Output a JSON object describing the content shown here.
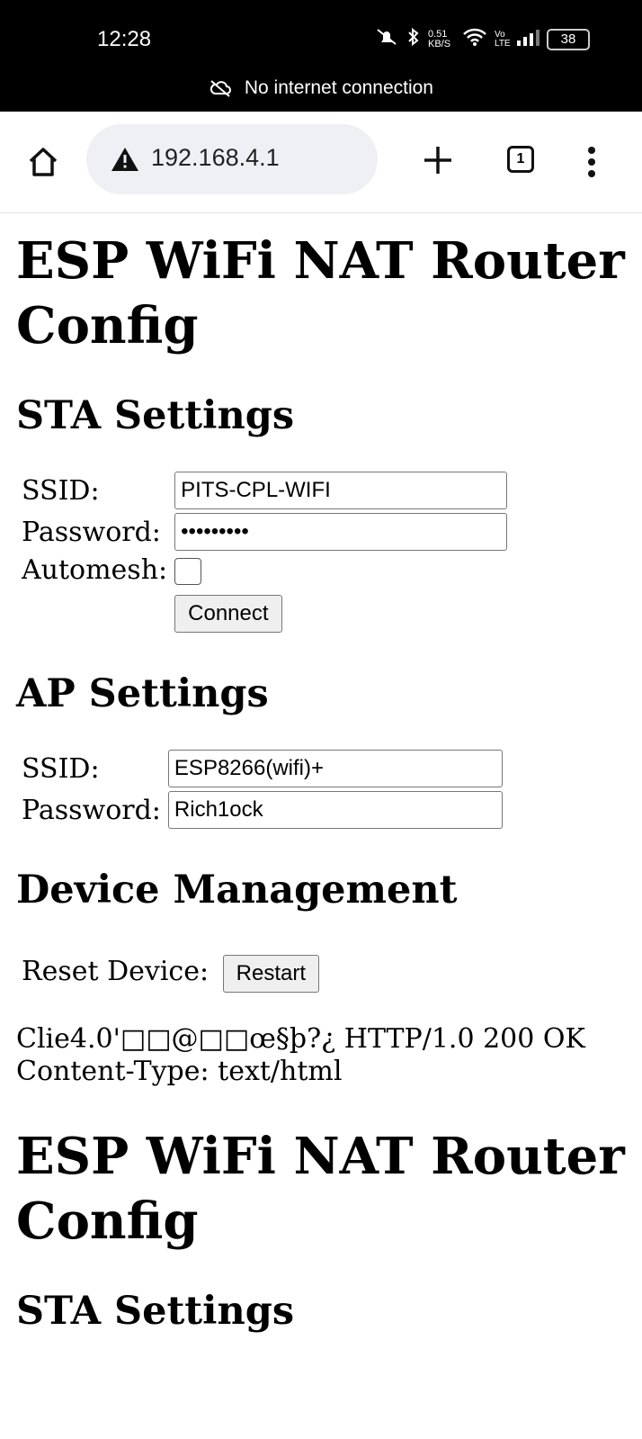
{
  "status_bar": {
    "time": "12:28",
    "net_speed": "0.51 KB/S",
    "network_badge": "Vo LTE",
    "battery": "38"
  },
  "net_banner": {
    "text": "No internet connection"
  },
  "browser": {
    "url": "192.168.4.1",
    "tab_count": "1"
  },
  "page": {
    "title": "ESP WiFi NAT Router Config",
    "sta": {
      "heading": "STA Settings",
      "ssid_label": "SSID:",
      "ssid_value": "PITS-CPL-WIFI",
      "password_label": "Password:",
      "password_value": "•••••••••",
      "automesh_label": "Automesh:",
      "connect_label": "Connect"
    },
    "ap": {
      "heading": "AP Settings",
      "ssid_label": "SSID:",
      "ssid_value": "ESP8266(wifi)+",
      "password_label": "Password:",
      "password_value": "Rich1ock"
    },
    "device": {
      "heading": "Device Management",
      "reset_label": "Reset Device:",
      "restart_label": "Restart"
    },
    "garbage_line1": "Clie4.0'□□@□□œ§þ?¿ HTTP/1.0 200 OK",
    "garbage_line2": "Content-Type: text/html",
    "title_repeat": "ESP WiFi NAT Router Config",
    "sta_heading_repeat": "STA Settings"
  }
}
